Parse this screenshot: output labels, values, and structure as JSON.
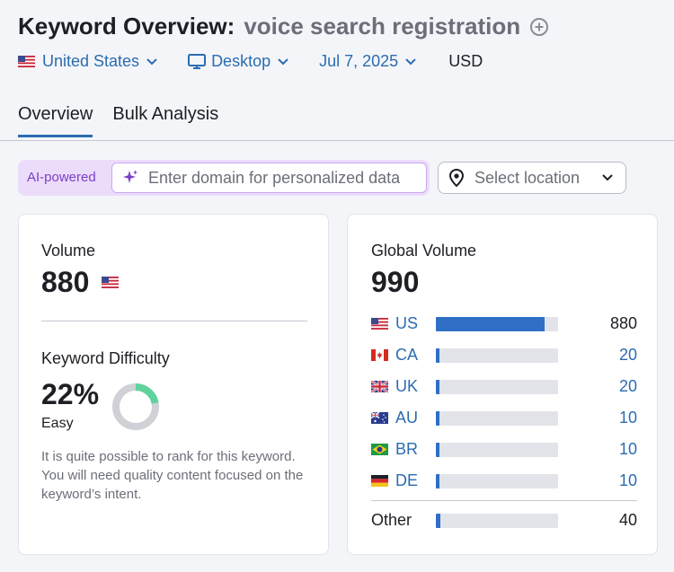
{
  "header": {
    "title": "Keyword Overview:",
    "keyword": "voice search registration",
    "add_icon": "plus-circle-icon"
  },
  "filters": {
    "country": "United States",
    "device": "Desktop",
    "date": "Jul 7, 2025",
    "currency": "USD"
  },
  "tabs": [
    {
      "label": "Overview",
      "active": true
    },
    {
      "label": "Bulk Analysis",
      "active": false
    }
  ],
  "ai": {
    "label": "AI-powered",
    "placeholder": "Enter domain for personalized data"
  },
  "location": {
    "placeholder": "Select location"
  },
  "volume_card": {
    "volume_label": "Volume",
    "volume_value": "880",
    "kd_label": "Keyword Difficulty",
    "kd_value": "22%",
    "kd_level": "Easy",
    "kd_fraction": 0.22,
    "kd_description": "It is quite possible to rank for this keyword. You will need quality content focused on the keyword’s intent."
  },
  "global_card": {
    "label": "Global Volume",
    "value": "990",
    "rows": [
      {
        "code": "US",
        "value": "880",
        "fraction": 0.89
      },
      {
        "code": "CA",
        "value": "20",
        "fraction": 0.03
      },
      {
        "code": "UK",
        "value": "20",
        "fraction": 0.03
      },
      {
        "code": "AU",
        "value": "10",
        "fraction": 0.03
      },
      {
        "code": "BR",
        "value": "10",
        "fraction": 0.03
      },
      {
        "code": "DE",
        "value": "10",
        "fraction": 0.03
      }
    ],
    "other": {
      "label": "Other",
      "value": "40",
      "fraction": 0.04
    }
  },
  "colors": {
    "accent": "#2b6cb0",
    "bar": "#2f6fc6",
    "kd_green": "#5fd39b",
    "kd_track": "#cfd1d6",
    "ai_purple": "#7b3fc6"
  }
}
